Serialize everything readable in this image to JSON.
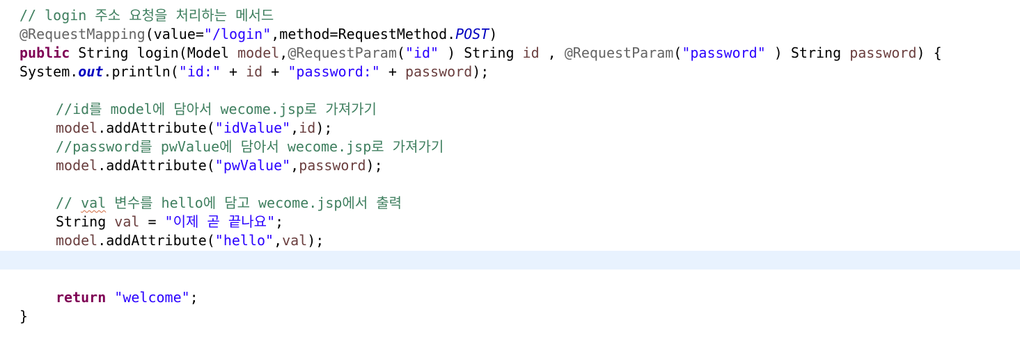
{
  "editor": {
    "language": "java",
    "colors": {
      "background": "#ffffff",
      "current_line": "#e8f2fe",
      "comment": "#3f7f5f",
      "keyword": "#7f0055",
      "string": "#2a00ff",
      "annotation": "#646464",
      "local_variable": "#6a3e3e",
      "static_field": "#0000c0",
      "warning_underline": "#d06b40"
    },
    "lines": [
      [
        {
          "t": "// login 주소 요청을 처리하는 메서드",
          "k": "comment"
        }
      ],
      [
        {
          "t": "@RequestMapping",
          "k": "ann"
        },
        {
          "t": "(value=",
          "k": "plain"
        },
        {
          "t": "\"/login\"",
          "k": "string"
        },
        {
          "t": ",method=RequestMethod.",
          "k": "plain"
        },
        {
          "t": "POST",
          "k": "const"
        },
        {
          "t": ")",
          "k": "plain"
        }
      ],
      [
        {
          "t": "public",
          "k": "keyword"
        },
        {
          "t": " String login(Model ",
          "k": "plain"
        },
        {
          "t": "model",
          "k": "var"
        },
        {
          "t": ",",
          "k": "plain"
        },
        {
          "t": "@RequestParam",
          "k": "ann"
        },
        {
          "t": "(",
          "k": "plain"
        },
        {
          "t": "\"id\"",
          "k": "string"
        },
        {
          "t": " ) String ",
          "k": "plain"
        },
        {
          "t": "id",
          "k": "var"
        },
        {
          "t": " , ",
          "k": "plain"
        },
        {
          "t": "@RequestParam",
          "k": "ann"
        },
        {
          "t": "(",
          "k": "plain"
        },
        {
          "t": "\"password\"",
          "k": "string"
        },
        {
          "t": " ) String ",
          "k": "plain"
        },
        {
          "t": "password",
          "k": "var"
        },
        {
          "t": ") {",
          "k": "plain"
        }
      ],
      [
        {
          "t": "System.",
          "k": "plain"
        },
        {
          "t": "out",
          "k": "field"
        },
        {
          "t": ".println(",
          "k": "plain"
        },
        {
          "t": "\"id:\"",
          "k": "string"
        },
        {
          "t": " + ",
          "k": "plain"
        },
        {
          "t": "id",
          "k": "var"
        },
        {
          "t": " + ",
          "k": "plain"
        },
        {
          "t": "\"password:\"",
          "k": "string"
        },
        {
          "t": " + ",
          "k": "plain"
        },
        {
          "t": "password",
          "k": "var"
        },
        {
          "t": ");",
          "k": "plain"
        }
      ],
      [],
      [
        {
          "t": "//id를 model에 담아서 wecome.jsp로 가져가기",
          "k": "comment"
        }
      ],
      [
        {
          "t": "model",
          "k": "var"
        },
        {
          "t": ".addAttribute(",
          "k": "plain"
        },
        {
          "t": "\"idValue\"",
          "k": "string"
        },
        {
          "t": ",",
          "k": "plain"
        },
        {
          "t": "id",
          "k": "var"
        },
        {
          "t": ");",
          "k": "plain"
        }
      ],
      [
        {
          "t": "//password를 pwValue에 담아서 wecome.jsp로 가져가기",
          "k": "comment"
        }
      ],
      [
        {
          "t": "model",
          "k": "var"
        },
        {
          "t": ".addAttribute(",
          "k": "plain"
        },
        {
          "t": "\"pwValue\"",
          "k": "string"
        },
        {
          "t": ",",
          "k": "plain"
        },
        {
          "t": "password",
          "k": "var"
        },
        {
          "t": ");",
          "k": "plain"
        }
      ],
      [],
      [
        {
          "t": "// ",
          "k": "comment"
        },
        {
          "t": "val",
          "k": "comment",
          "warn": true
        },
        {
          "t": " 변수를 hello에 담고 wecome.jsp에서 출력",
          "k": "comment"
        }
      ],
      [
        {
          "t": "String ",
          "k": "plain"
        },
        {
          "t": "val",
          "k": "var"
        },
        {
          "t": " = ",
          "k": "plain"
        },
        {
          "t": "\"이제 곧 끝나요\"",
          "k": "string"
        },
        {
          "t": ";",
          "k": "plain"
        }
      ],
      [
        {
          "t": "model",
          "k": "var"
        },
        {
          "t": ".addAttribute(",
          "k": "plain"
        },
        {
          "t": "\"hello\"",
          "k": "string"
        },
        {
          "t": ",",
          "k": "plain"
        },
        {
          "t": "val",
          "k": "var"
        },
        {
          "t": ");",
          "k": "plain"
        }
      ],
      [],
      [],
      [
        {
          "t": "return",
          "k": "keyword"
        },
        {
          "t": " ",
          "k": "plain"
        },
        {
          "t": "\"welcome\"",
          "k": "string"
        },
        {
          "t": ";",
          "k": "plain"
        }
      ],
      [
        {
          "t": "}",
          "k": "plain"
        }
      ]
    ]
  }
}
